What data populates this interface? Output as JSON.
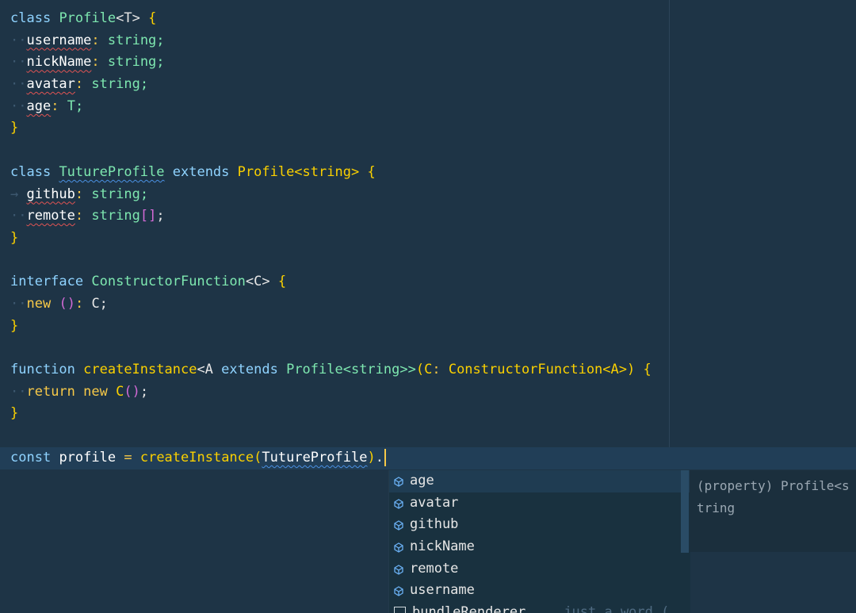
{
  "code": {
    "l1": [
      "class",
      "Profile",
      "<T>",
      "{"
    ],
    "props1": [
      {
        "name": "username",
        "type": "string;"
      },
      {
        "name": "nickName",
        "type": "string;"
      },
      {
        "name": "avatar",
        "type": "string;"
      },
      {
        "name": "age",
        "type": "T;"
      }
    ],
    "class2": {
      "kw": "class",
      "name": "TutureProfile",
      "ext": "extends",
      "base": "Profile<string>",
      "brace": "{"
    },
    "props2": [
      {
        "name": "github",
        "type": "string;"
      },
      {
        "name": "remote",
        "type": "string",
        "arr": "[]",
        "semi": ";"
      }
    ],
    "iface": {
      "kw": "interface",
      "name": "ConstructorFunction",
      "gen": "<C>",
      "brace": "{"
    },
    "new_line": {
      "kw": "new",
      "paren": "()",
      "colon": ":",
      "type": "C;"
    },
    "func": {
      "kw": "function",
      "name": "createInstance",
      "gen1": "<A",
      "ext": "extends",
      "base": "Profile<string>>",
      "p1": "(C",
      "colon": ":",
      "ptype": "ConstructorFunction<A>)",
      "brace": "{"
    },
    "ret": {
      "kw": "return",
      "kw2": "new",
      "call": "C",
      "paren": "()",
      "semi": ";"
    },
    "close": "}",
    "const": {
      "kw": "const",
      "name": "profile",
      "eq": "=",
      "fn": "createInstance",
      "open": "(",
      "arg": "TutureProfile",
      "close": ")",
      "dot": "."
    }
  },
  "suggestions": [
    {
      "label": "age",
      "icon": "property-icon"
    },
    {
      "label": "avatar",
      "icon": "property-icon"
    },
    {
      "label": "github",
      "icon": "property-icon"
    },
    {
      "label": "nickName",
      "icon": "property-icon"
    },
    {
      "label": "remote",
      "icon": "property-icon"
    },
    {
      "label": "username",
      "icon": "property-icon"
    },
    {
      "label": "bundleRenderer",
      "icon": "word-icon",
      "hint": "just a word ("
    }
  ],
  "details": {
    "line1": "(property) Profile<s",
    "line2": "tring"
  },
  "colors": {
    "background": "#1e3446",
    "caret": "#f7c948",
    "selected": "#1f3c52"
  }
}
